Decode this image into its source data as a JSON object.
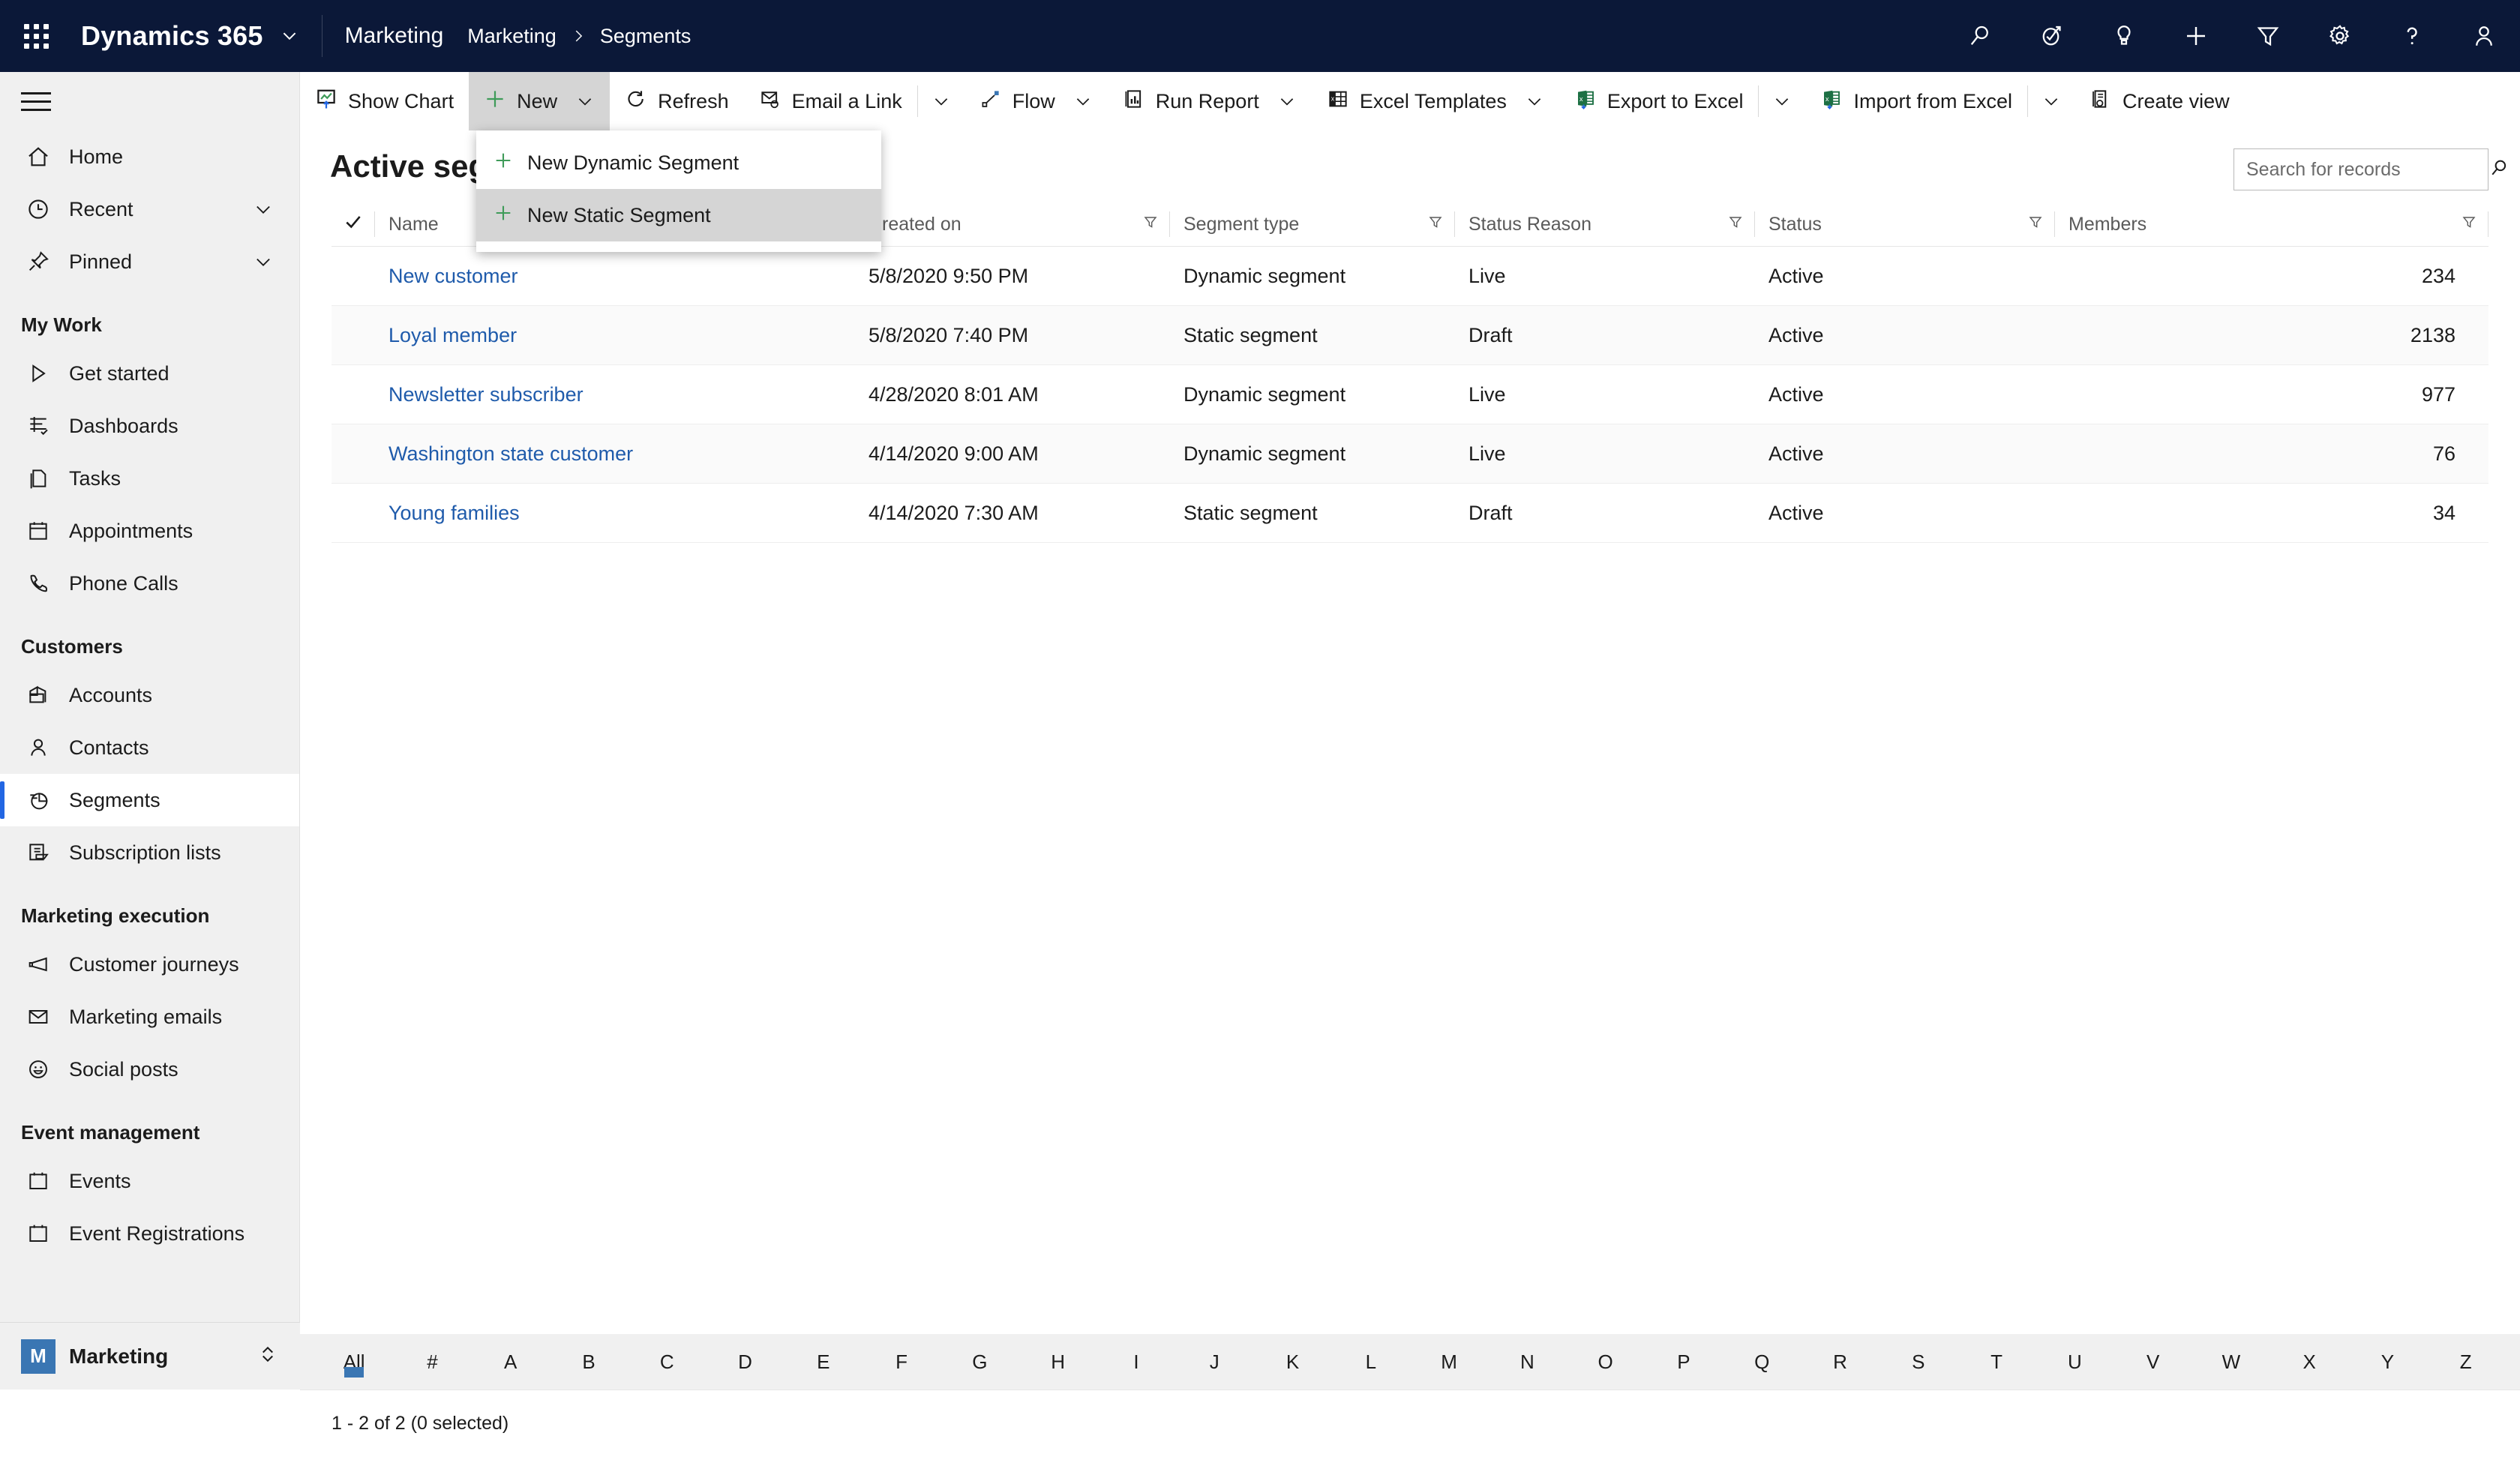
{
  "header": {
    "waffle_icon": "app-launcher-icon",
    "brand": "Dynamics 365",
    "brand_caret_icon": "chevron-down-icon",
    "app_name": "Marketing",
    "breadcrumb": [
      "Marketing",
      "Segments"
    ],
    "breadcrumb_sep_icon": "chevron-right-icon",
    "right_icons": [
      {
        "name": "search-icon",
        "title": "Search"
      },
      {
        "name": "assistant-icon",
        "title": "Assistant"
      },
      {
        "name": "lightbulb-icon",
        "title": "Insights"
      },
      {
        "name": "plus-icon",
        "title": "Quick create"
      },
      {
        "name": "filter-icon",
        "title": "Filter"
      },
      {
        "name": "gear-icon",
        "title": "Settings"
      },
      {
        "name": "help-icon",
        "title": "Help"
      },
      {
        "name": "person-icon",
        "title": "Account"
      }
    ]
  },
  "sidebar": {
    "hamburger_icon": "hamburger-icon",
    "top_items": [
      {
        "label": "Home",
        "icon": "home-icon",
        "expandable": false,
        "active": false
      },
      {
        "label": "Recent",
        "icon": "clock-icon",
        "expandable": true,
        "active": false
      },
      {
        "label": "Pinned",
        "icon": "pin-icon",
        "expandable": true,
        "active": false
      }
    ],
    "groups": [
      {
        "title": "My Work",
        "items": [
          {
            "label": "Get started",
            "icon": "play-icon",
            "active": false
          },
          {
            "label": "Dashboards",
            "icon": "dashboard-icon",
            "active": false
          },
          {
            "label": "Tasks",
            "icon": "tasks-icon",
            "active": false
          },
          {
            "label": "Appointments",
            "icon": "calendar-icon",
            "active": false
          },
          {
            "label": "Phone Calls",
            "icon": "phone-icon",
            "active": false
          }
        ]
      },
      {
        "title": "Customers",
        "items": [
          {
            "label": "Accounts",
            "icon": "accounts-icon",
            "active": false
          },
          {
            "label": "Contacts",
            "icon": "contact-icon",
            "active": false
          },
          {
            "label": "Segments",
            "icon": "segments-pie-icon",
            "active": true
          },
          {
            "label": "Subscription lists",
            "icon": "subscription-list-icon",
            "active": false
          }
        ]
      },
      {
        "title": "Marketing execution",
        "items": [
          {
            "label": "Customer journeys",
            "icon": "megaphone-icon",
            "active": false
          },
          {
            "label": "Marketing emails",
            "icon": "envelope-icon",
            "active": false
          },
          {
            "label": "Social posts",
            "icon": "smiley-icon",
            "active": false
          }
        ]
      },
      {
        "title": "Event management",
        "items": [
          {
            "label": "Events",
            "icon": "calendar-icon",
            "active": false
          },
          {
            "label": "Event Registrations",
            "icon": "calendar-icon",
            "active": false
          }
        ]
      }
    ],
    "area_switcher": {
      "badge": "M",
      "label": "Marketing",
      "badge_color": "#3a76b3",
      "chevron_icon": "chevron-updown-icon"
    }
  },
  "commandbar": {
    "items": [
      {
        "label": "Show Chart",
        "icon": "show-chart-icon",
        "caret": false,
        "split": false,
        "active": false
      },
      {
        "label": "New",
        "icon": "plus-green-icon",
        "caret": true,
        "split": false,
        "active": true
      },
      {
        "label": "Refresh",
        "icon": "refresh-icon",
        "caret": false,
        "split": false,
        "active": false
      },
      {
        "label": "Email a Link",
        "icon": "email-link-icon",
        "caret": false,
        "split": true,
        "active": false
      },
      {
        "label": "Flow",
        "icon": "flow-icon",
        "caret": true,
        "split": false,
        "active": false
      },
      {
        "label": "Run Report",
        "icon": "run-report-icon",
        "caret": true,
        "split": false,
        "active": false
      },
      {
        "label": "Excel Templates",
        "icon": "excel-templates-icon",
        "caret": true,
        "split": false,
        "active": false
      },
      {
        "label": "Export to Excel",
        "icon": "excel-export-icon",
        "caret": false,
        "split": true,
        "active": false
      },
      {
        "label": "Import from Excel",
        "icon": "excel-import-icon",
        "caret": false,
        "split": true,
        "active": false
      },
      {
        "label": "Create view",
        "icon": "create-view-icon",
        "caret": false,
        "split": false,
        "active": false
      }
    ]
  },
  "new_menu": {
    "open": true,
    "items": [
      {
        "label": "New Dynamic Segment",
        "icon": "plus-green-icon",
        "hovered": false
      },
      {
        "label": "New Static Segment",
        "icon": "plus-green-icon",
        "hovered": true
      }
    ]
  },
  "view": {
    "title": "Active segments",
    "search_placeholder": "Search for records",
    "search_value": "",
    "search_icon": "search-icon"
  },
  "grid": {
    "select_all_icon": "checkmark-icon",
    "columns": [
      {
        "label": "Name",
        "sorted": true,
        "sort_icon": "arrow-up-icon",
        "filter_icon": "filter-icon",
        "align": "left"
      },
      {
        "label": "Created on",
        "sorted": false,
        "filter_icon": "filter-icon",
        "align": "left"
      },
      {
        "label": "Segment type",
        "sorted": false,
        "filter_icon": "filter-icon",
        "align": "left"
      },
      {
        "label": "Status Reason",
        "sorted": false,
        "filter_icon": "filter-icon",
        "align": "left"
      },
      {
        "label": "Status",
        "sorted": false,
        "filter_icon": "filter-icon",
        "align": "left"
      },
      {
        "label": "Members",
        "sorted": false,
        "filter_icon": "filter-icon",
        "align": "right"
      }
    ],
    "rows": [
      {
        "name": "New customer",
        "created_on": "5/8/2020 9:50 PM",
        "segment_type": "Dynamic segment",
        "status_reason": "Live",
        "status": "Active",
        "members": "234"
      },
      {
        "name": "Loyal member",
        "created_on": "5/8/2020 7:40 PM",
        "segment_type": "Static segment",
        "status_reason": "Draft",
        "status": "Active",
        "members": "2138"
      },
      {
        "name": "Newsletter subscriber",
        "created_on": "4/28/2020 8:01 AM",
        "segment_type": "Dynamic segment",
        "status_reason": "Live",
        "status": "Active",
        "members": "977"
      },
      {
        "name": "Washington state customer",
        "created_on": "4/14/2020 9:00 AM",
        "segment_type": "Dynamic segment",
        "status_reason": "Live",
        "status": "Active",
        "members": "76"
      },
      {
        "name": "Young families",
        "created_on": "4/14/2020 7:30 AM",
        "segment_type": "Static segment",
        "status_reason": "Draft",
        "status": "Active",
        "members": "34"
      }
    ]
  },
  "alphabar": {
    "selected": "All",
    "items": [
      "All",
      "#",
      "A",
      "B",
      "C",
      "D",
      "E",
      "F",
      "G",
      "H",
      "I",
      "J",
      "K",
      "L",
      "M",
      "N",
      "O",
      "P",
      "Q",
      "R",
      "S",
      "T",
      "U",
      "V",
      "W",
      "X",
      "Y",
      "Z"
    ]
  },
  "statusbar": {
    "text": "1 - 2 of 2 (0 selected)"
  },
  "colors": {
    "header_bg": "#0b1838",
    "sidebar_bg": "#f0f0f0",
    "accent_blue": "#2266e3",
    "link_blue": "#1f5bab",
    "green": "#4a9a5a",
    "excel_green": "#1d7044",
    "active_gray": "#d5d5d5"
  }
}
